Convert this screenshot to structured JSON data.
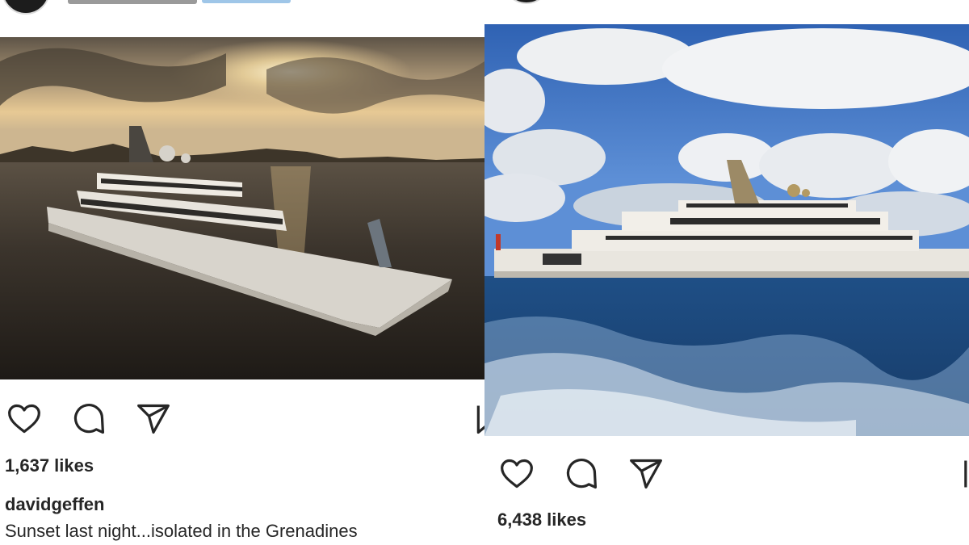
{
  "posts": [
    {
      "likes": "1,637 likes",
      "username": "davidgeffen",
      "caption": "Sunset last night...isolated in the Grenadines",
      "photo": {
        "subject": "superyacht at sunset",
        "sky_color": "#8a7f6e",
        "sea_color": "#2b2621"
      },
      "icons": [
        "heart-icon",
        "comment-icon",
        "share-icon",
        "bookmark-icon"
      ]
    },
    {
      "likes": "6,438 likes",
      "photo": {
        "subject": "superyacht under blue sky",
        "sky_color": "#3f74c4",
        "sea_color": "#1f4f86"
      },
      "icons": [
        "heart-icon",
        "comment-icon",
        "share-icon",
        "bookmark-icon"
      ]
    }
  ]
}
